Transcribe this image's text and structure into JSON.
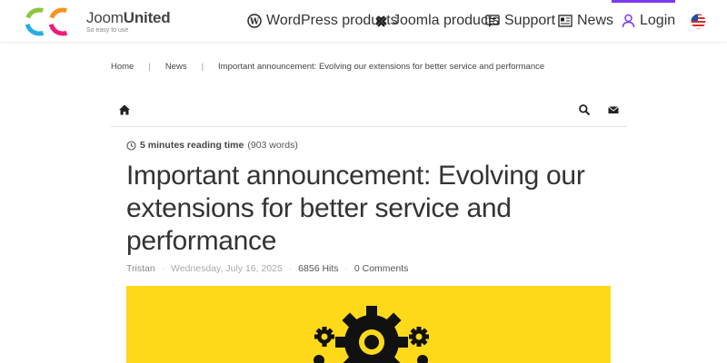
{
  "brand": {
    "name_light": "Joom",
    "name_bold": "United",
    "tagline": "So easy to use"
  },
  "nav": {
    "wordpress": "WordPress products",
    "joomla": "Joomla products",
    "support": "Support",
    "news": "News",
    "login": "Login"
  },
  "icons": {
    "wordpress": "wordpress-icon",
    "joomla": "joomla-icon",
    "support": "chat-icon",
    "news": "newspaper-icon",
    "login": "user-icon",
    "language": "us-flag-icon",
    "home": "home-icon",
    "search": "search-icon",
    "email": "envelope-icon",
    "clock": "clock-icon",
    "feature": "gears-icon"
  },
  "colors": {
    "accent": "#7c3aed",
    "feature_bg": "#ffd91a"
  },
  "breadcrumb": {
    "home": "Home",
    "news": "News",
    "current": "Important announcement: Evolving our extensions for better service and performance",
    "separator": "|"
  },
  "article": {
    "reading_time": "5 minutes reading time",
    "word_count": "(903 words)",
    "title": "Important announcement: Evolving our extensions for better service and performance",
    "author": "Tristan",
    "date": "Wednesday, July 16, 2025",
    "hits": "6856 Hits",
    "comments": "0 Comments",
    "meta_sep": "·"
  }
}
